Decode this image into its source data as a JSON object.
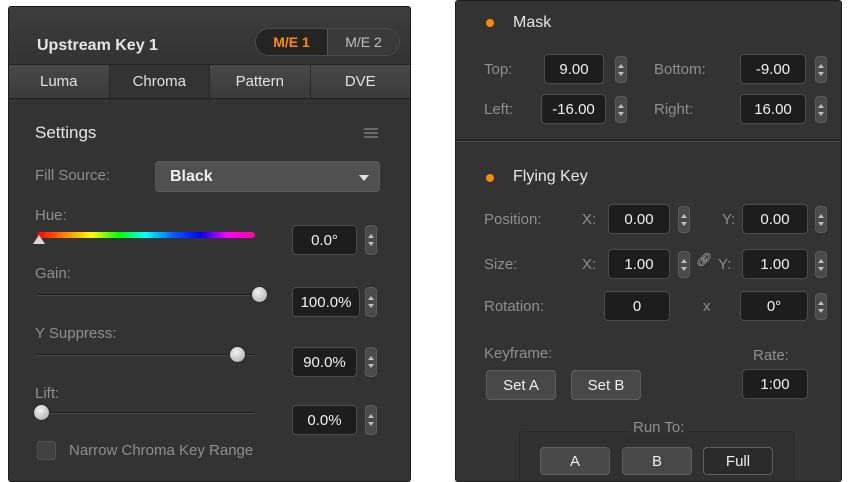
{
  "upstream_key": {
    "title": "Upstream Key 1",
    "me_switch": {
      "active": "M/E 1",
      "inactive": "M/E 2"
    },
    "tabs": [
      "Luma",
      "Chroma",
      "Pattern",
      "DVE"
    ],
    "selected_tab": "Chroma",
    "settings_label": "Settings",
    "fill_source": {
      "label": "Fill Source:",
      "value": "Black"
    },
    "hue": {
      "label": "Hue:",
      "value": "0.0°",
      "level": 0.0
    },
    "gain": {
      "label": "Gain:",
      "value": "100.0%",
      "level": 1.0
    },
    "y_suppress": {
      "label": "Y Suppress:",
      "value": "90.0%",
      "level": 0.9
    },
    "lift": {
      "label": "Lift:",
      "value": "0.0%",
      "level": 0.0
    },
    "narrow_range": {
      "label": "Narrow Chroma Key Range",
      "checked": false
    }
  },
  "mask": {
    "title": "Mask",
    "top": {
      "label": "Top:",
      "value": "9.00"
    },
    "bottom": {
      "label": "Bottom:",
      "value": "-9.00"
    },
    "left": {
      "label": "Left:",
      "value": "-16.00"
    },
    "right": {
      "label": "Right:",
      "value": "16.00"
    }
  },
  "flying_key": {
    "title": "Flying Key",
    "position": {
      "label": "Position:",
      "x_label": "X:",
      "x": "0.00",
      "y_label": "Y:",
      "y": "0.00"
    },
    "size": {
      "label": "Size:",
      "x_label": "X:",
      "x": "1.00",
      "y_label": "Y:",
      "y": "1.00"
    },
    "rotation": {
      "label": "Rotation:",
      "value": "0",
      "x_label": "x",
      "degrees": "0°"
    },
    "keyframe": {
      "label": "Keyframe:",
      "set_a": "Set A",
      "set_b": "Set B"
    },
    "rate": {
      "label": "Rate:",
      "value": "1:00"
    },
    "run_to": {
      "label": "Run To:",
      "a": "A",
      "b": "B",
      "full": "Full"
    }
  },
  "colors": {
    "accent": "#ff8a00",
    "panel": "#333333",
    "field": "#1d1d1d"
  },
  "icons": [
    "menu-icon",
    "caret-down-icon",
    "stepper-icon",
    "hue-pointer-icon",
    "slider-knob-icon",
    "status-dot-icon",
    "link-icon"
  ]
}
